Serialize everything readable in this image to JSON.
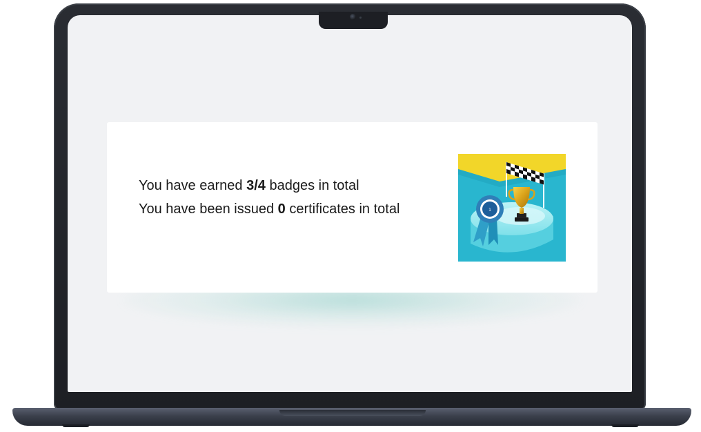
{
  "summary": {
    "badges_prefix": "You have earned ",
    "badges_value": "3/4",
    "badges_suffix": " badges in total",
    "certificates_prefix": "You have been issued ",
    "certificates_value": "0",
    "certificates_suffix": " certificates in total"
  },
  "illustration": {
    "icon": "trophy-rosette-illustration",
    "colors": {
      "background_top": "#f2d629",
      "background_bottom": "#29b6cf",
      "platform": "#7fe0ea",
      "trophy": "#d9a21a",
      "rosette": "#2f7fb8"
    }
  }
}
